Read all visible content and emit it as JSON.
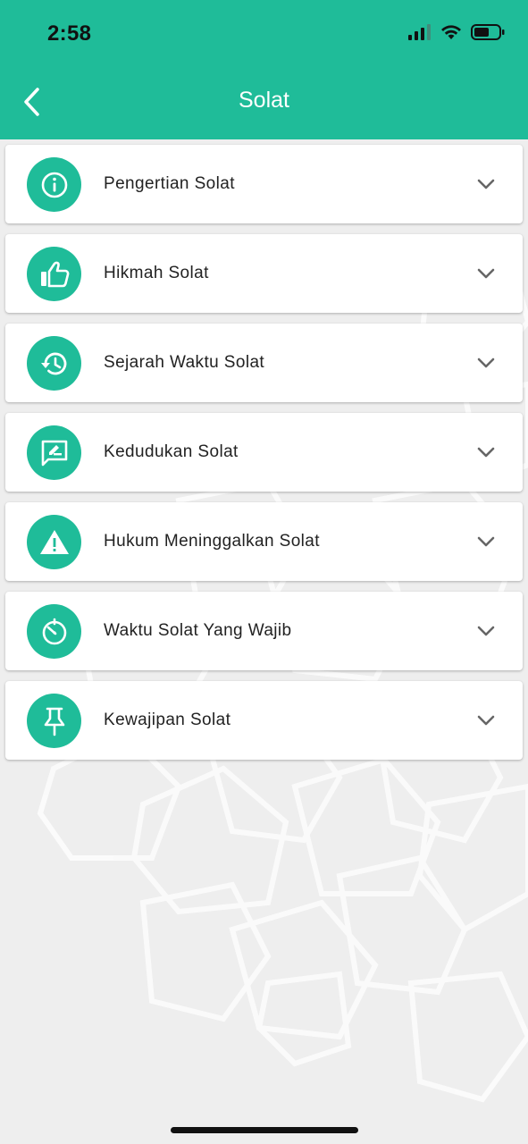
{
  "status_bar": {
    "time": "2:58",
    "icons": [
      "signal-icon",
      "wifi-icon",
      "battery-icon"
    ]
  },
  "header": {
    "title": "Solat",
    "back_icon": "chevron-left-icon"
  },
  "theme": {
    "accent": "#1fbc99",
    "background": "#eeeeee",
    "card": "#ffffff",
    "text": "#222222"
  },
  "items": [
    {
      "label": "Pengertian Solat",
      "icon": "info-icon"
    },
    {
      "label": "Hikmah Solat",
      "icon": "thumbs-up-icon"
    },
    {
      "label": "Sejarah Waktu Solat",
      "icon": "history-icon"
    },
    {
      "label": "Kedudukan Solat",
      "icon": "rate-review-icon"
    },
    {
      "label": "Hukum Meninggalkan Solat",
      "icon": "warning-icon"
    },
    {
      "label": "Waktu Solat Yang Wajib",
      "icon": "timer-icon"
    },
    {
      "label": "Kewajipan Solat",
      "icon": "pin-icon"
    }
  ]
}
